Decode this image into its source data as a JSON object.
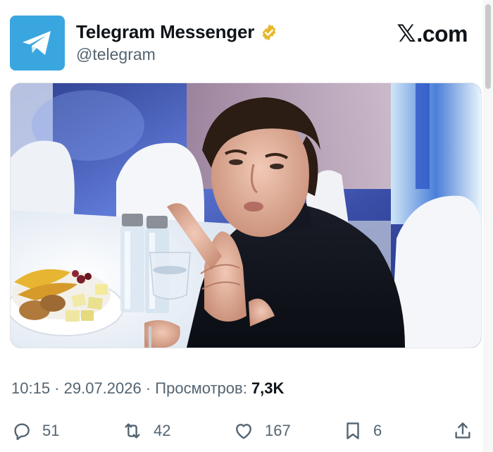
{
  "tweet": {
    "author": {
      "display_name": "Telegram Messenger",
      "handle": "@telegram",
      "verified_badge": "gold-verified-badge-icon",
      "avatar_icon": "telegram-paper-plane-icon",
      "avatar_color": "#3aa6e0"
    },
    "site_logo": {
      "mark": "𝕏",
      "text": ".com"
    },
    "media": {
      "alt": "photo"
    },
    "meta": {
      "time": "10:15",
      "separator_1": " · ",
      "date": "29.07.2026",
      "separator_2": " · ",
      "views_label": "Просмотров:",
      "views_count": "7,3K"
    },
    "actions": {
      "replies": "51",
      "reposts": "42",
      "likes": "167",
      "bookmarks": "6"
    }
  },
  "colors": {
    "text_primary": "#0f1419",
    "text_secondary": "#536471",
    "verified_gold": "#e8b829"
  }
}
